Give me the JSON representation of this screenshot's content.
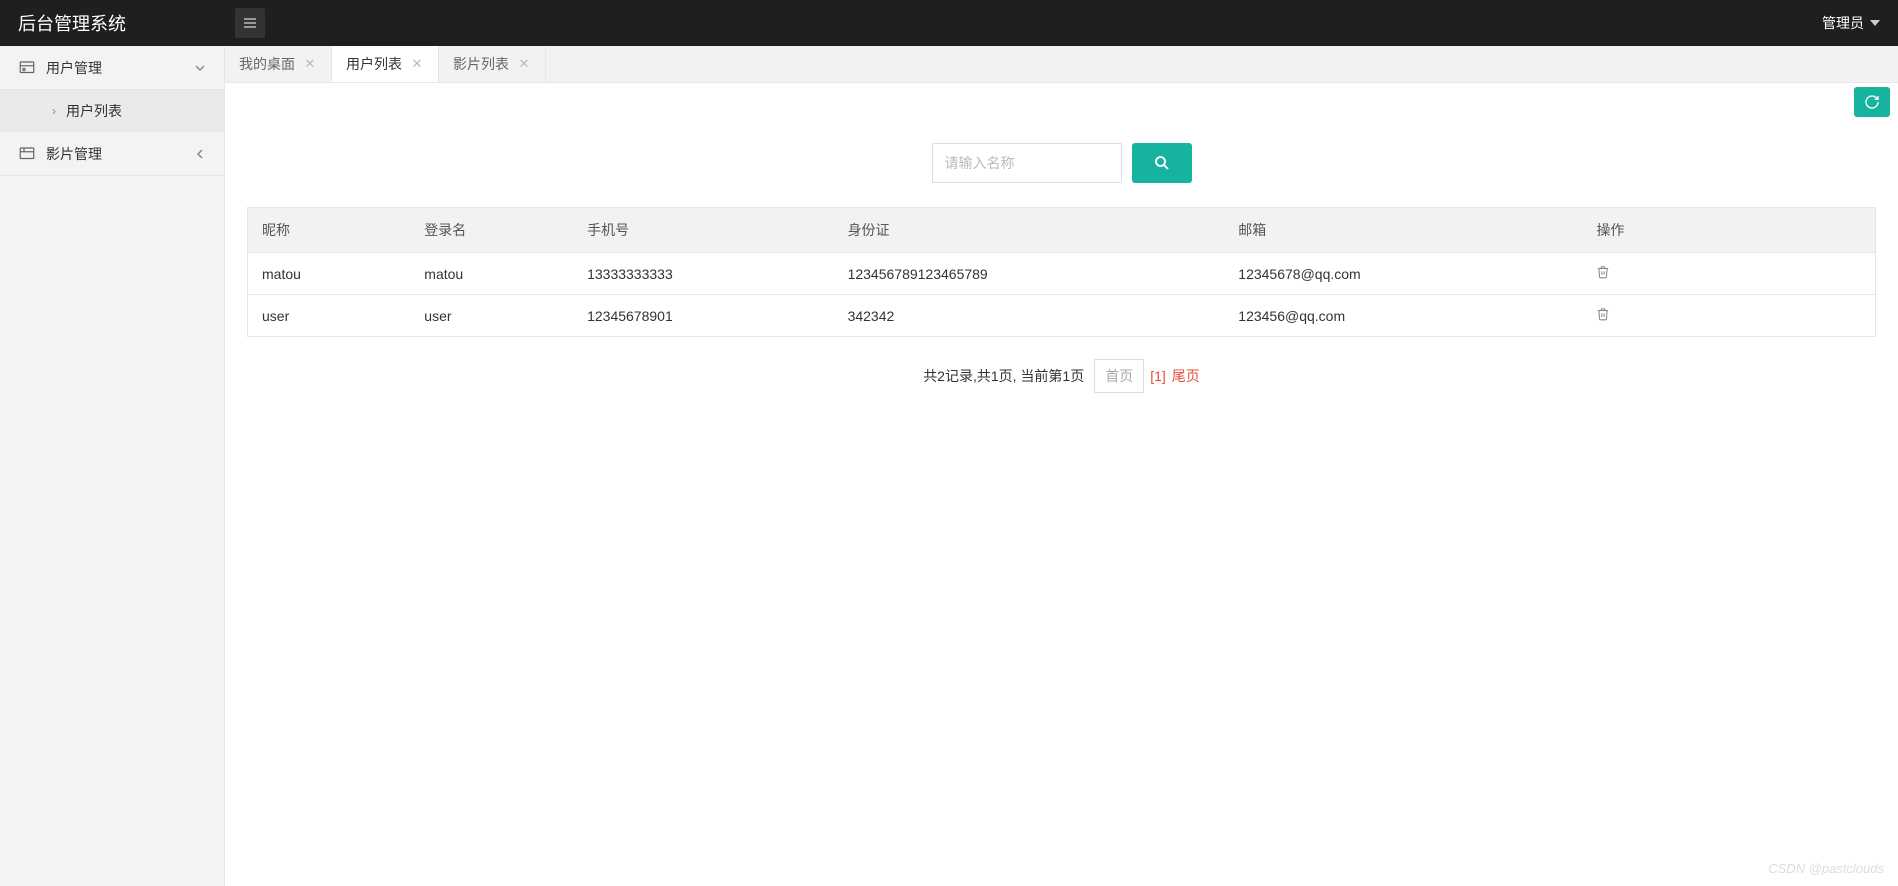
{
  "header": {
    "title": "后台管理系统",
    "user": "管理员"
  },
  "sidebar": {
    "items": [
      {
        "label": "用户管理",
        "expanded": true,
        "children": [
          {
            "label": "用户列表"
          }
        ]
      },
      {
        "label": "影片管理",
        "expanded": false
      }
    ]
  },
  "tabs": [
    {
      "label": "我的桌面",
      "closable": true,
      "active": false
    },
    {
      "label": "用户列表",
      "closable": true,
      "active": true
    },
    {
      "label": "影片列表",
      "closable": true,
      "active": false
    }
  ],
  "search": {
    "placeholder": "请输入名称"
  },
  "table": {
    "columns": [
      "昵称",
      "登录名",
      "手机号",
      "身份证",
      "邮箱",
      "操作"
    ],
    "rows": [
      {
        "nickname": "matou",
        "login": "matou",
        "phone": "13333333333",
        "idcard": "123456789123465789",
        "email": "12345678@qq.com"
      },
      {
        "nickname": "user",
        "login": "user",
        "phone": "12345678901",
        "idcard": "342342",
        "email": "123456@qq.com"
      }
    ]
  },
  "pagination": {
    "info": "共2记录,共1页, 当前第1页",
    "first": "首页",
    "current": "[1]",
    "last": "尾页"
  },
  "watermark": "CSDN @pastclouds"
}
